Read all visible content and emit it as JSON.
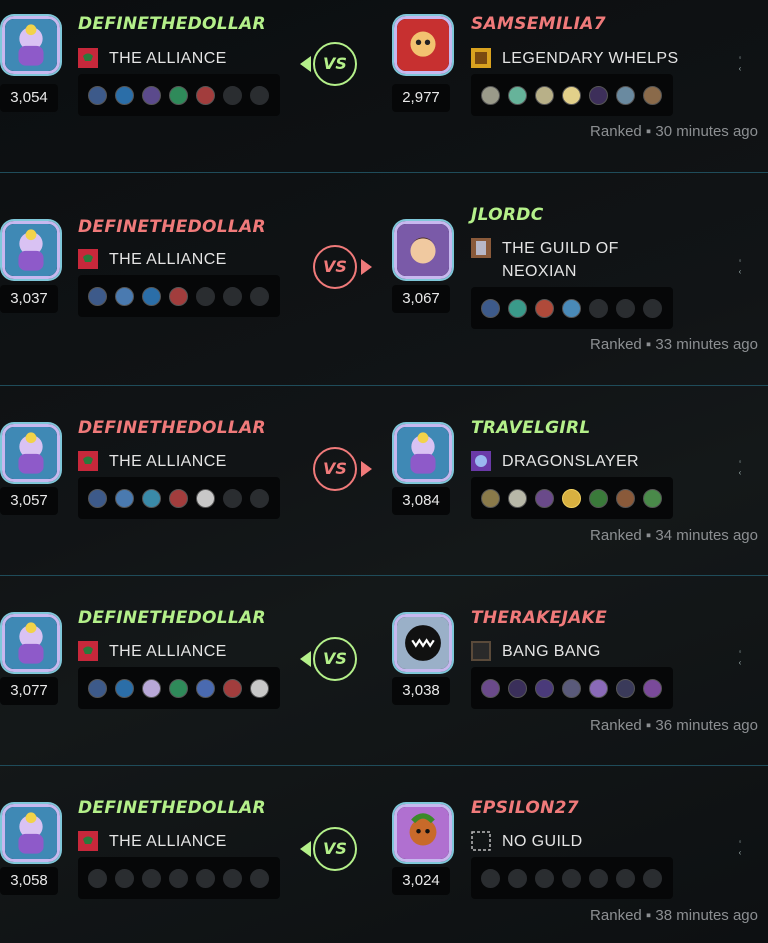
{
  "battles": [
    {
      "player1": {
        "name": "DEFINETHEDOLLAR",
        "rating": "3,054",
        "guild": "THE ALLIANCE",
        "result": "win"
      },
      "player2": {
        "name": "SAMSEMILIA7",
        "rating": "2,977",
        "guild": "LEGENDARY WHELPS",
        "result": "lose"
      },
      "vs_label": "VS",
      "mode": "Ranked",
      "time": "30 minutes ago"
    },
    {
      "player1": {
        "name": "DEFINETHEDOLLAR",
        "rating": "3,037",
        "guild": "THE ALLIANCE",
        "result": "lose"
      },
      "player2": {
        "name": "JLORDC",
        "rating": "3,067",
        "guild": "THE GUILD OF NEOXIAN",
        "result": "win"
      },
      "vs_label": "VS",
      "mode": "Ranked",
      "time": "33 minutes ago"
    },
    {
      "player1": {
        "name": "DEFINETHEDOLLAR",
        "rating": "3,057",
        "guild": "THE ALLIANCE",
        "result": "lose"
      },
      "player2": {
        "name": "TRAVELGIRL",
        "rating": "3,084",
        "guild": "DRAGONSLAYER",
        "result": "win"
      },
      "vs_label": "VS",
      "mode": "Ranked",
      "time": "34 minutes ago"
    },
    {
      "player1": {
        "name": "DEFINETHEDOLLAR",
        "rating": "3,077",
        "guild": "THE ALLIANCE",
        "result": "win"
      },
      "player2": {
        "name": "THERAKEJAKE",
        "rating": "3,038",
        "guild": "BANG BANG",
        "result": "lose"
      },
      "vs_label": "VS",
      "mode": "Ranked",
      "time": "36 minutes ago"
    },
    {
      "player1": {
        "name": "DEFINETHEDOLLAR",
        "rating": "3,058",
        "guild": "THE ALLIANCE",
        "result": "win"
      },
      "player2": {
        "name": "EPSILON27",
        "rating": "3,024",
        "guild": "NO GUILD",
        "result": "lose"
      },
      "vs_label": "VS",
      "mode": "Ranked",
      "time": "38 minutes ago"
    }
  ],
  "colors": {
    "win": "#b4f08a",
    "lose": "#f07a7a",
    "divider": "#1f4c5a",
    "panel": "#060708"
  },
  "icons": {
    "guild_alliance": "red-banner-icon",
    "guild_none": "dashed-square-icon",
    "side_control": "chevron-icon"
  }
}
